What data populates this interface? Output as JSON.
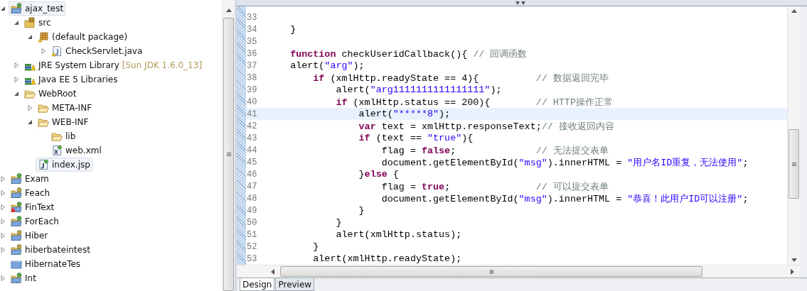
{
  "tree": [
    {
      "label": "ajax_test",
      "kind": "project",
      "expanded": true,
      "selected": true,
      "children": [
        {
          "label": "src",
          "kind": "source-folder",
          "expanded": true,
          "selected": false,
          "children": [
            {
              "label": "(default package)",
              "kind": "package",
              "expanded": true,
              "selected": false,
              "children": [
                {
                  "label": "CheckServlet.java",
                  "kind": "java-file",
                  "expanded": false,
                  "selected": false
                }
              ]
            }
          ]
        },
        {
          "label": "JRE System Library",
          "decoration": "[Sun JDK 1.6.0_13]",
          "kind": "library",
          "expanded": false,
          "selected": false
        },
        {
          "label": "Java EE 5 Libraries",
          "kind": "library",
          "expanded": false,
          "selected": false
        },
        {
          "label": "WebRoot",
          "kind": "folder",
          "expanded": true,
          "selected": false,
          "children": [
            {
              "label": "META-INF",
              "kind": "folder",
              "expanded": false,
              "selected": false
            },
            {
              "label": "WEB-INF",
              "kind": "folder",
              "expanded": true,
              "selected": false,
              "children": [
                {
                  "label": "lib",
                  "kind": "folder",
                  "selected": false
                },
                {
                  "label": "web.xml",
                  "kind": "xml-file",
                  "selected": false
                }
              ]
            },
            {
              "label": "index.jsp",
              "kind": "jsp-file",
              "selected": true
            }
          ]
        }
      ]
    },
    {
      "label": "Exam",
      "kind": "project",
      "expanded": false,
      "selected": false
    },
    {
      "label": "Feach",
      "kind": "project-alt",
      "expanded": false,
      "selected": false
    },
    {
      "label": "FinText",
      "kind": "project-error",
      "expanded": false,
      "selected": false
    },
    {
      "label": "ForEach",
      "kind": "project",
      "expanded": false,
      "selected": false
    },
    {
      "label": "Hiber",
      "kind": "project-alt",
      "expanded": false,
      "selected": false
    },
    {
      "label": "hiberbateintest",
      "kind": "project-alt",
      "expanded": false,
      "selected": false
    },
    {
      "label": "HibernateTes",
      "kind": "closed-project",
      "selected": false
    },
    {
      "label": "Int",
      "kind": "project",
      "expanded": false,
      "selected": false
    }
  ],
  "code": [
    {
      "number": "33",
      "current": false
    },
    {
      "number": "34",
      "current": false,
      "segments": [
        {
          "kind": "plain",
          "text": "    }"
        }
      ]
    },
    {
      "number": "35",
      "current": false
    },
    {
      "number": "36",
      "current": false,
      "segments": [
        {
          "kind": "kw",
          "text": "    function"
        },
        {
          "kind": "plain",
          "text": " checkUseridCallback(){ "
        },
        {
          "kind": "cmt",
          "text": "// 回调函数"
        }
      ]
    },
    {
      "number": "37",
      "current": false,
      "segments": [
        {
          "kind": "plain",
          "text": "    alert("
        },
        {
          "kind": "str",
          "text": "\"arg\""
        },
        {
          "kind": "plain",
          "text": ");"
        }
      ]
    },
    {
      "number": "38",
      "current": false,
      "segments": [
        {
          "kind": "kw",
          "text": "        if"
        },
        {
          "kind": "plain",
          "text": " (xmlHttp.readyState == 4){          "
        },
        {
          "kind": "cmt",
          "text": "// 数据返回完毕"
        }
      ]
    },
    {
      "number": "39",
      "current": false,
      "segments": [
        {
          "kind": "plain",
          "text": "            alert("
        },
        {
          "kind": "str",
          "text": "\"arg1111111111111111\""
        },
        {
          "kind": "plain",
          "text": ");"
        }
      ]
    },
    {
      "number": "40",
      "current": false,
      "segments": [
        {
          "kind": "kw",
          "text": "            if"
        },
        {
          "kind": "plain",
          "text": " (xmlHttp.status == 200){        "
        },
        {
          "kind": "cmt",
          "text": "// HTTP操作正常"
        }
      ]
    },
    {
      "number": "41",
      "current": true,
      "segments": [
        {
          "kind": "plain",
          "text": "                alert("
        },
        {
          "kind": "str",
          "text": "\"*****8\""
        },
        {
          "kind": "plain",
          "text": ");"
        }
      ]
    },
    {
      "number": "42",
      "current": false,
      "segments": [
        {
          "kind": "kw",
          "text": "                var"
        },
        {
          "kind": "plain",
          "text": " text = xmlHttp.responseText;"
        },
        {
          "kind": "cmt",
          "text": "// 接收返回内容"
        }
      ]
    },
    {
      "number": "43",
      "current": false,
      "segments": [
        {
          "kind": "kw",
          "text": "                if"
        },
        {
          "kind": "plain",
          "text": " (text == "
        },
        {
          "kind": "str",
          "text": "\"true\""
        },
        {
          "kind": "plain",
          "text": "){"
        }
      ]
    },
    {
      "number": "44",
      "current": false,
      "segments": [
        {
          "kind": "plain",
          "text": "                    flag = "
        },
        {
          "kind": "kw",
          "text": "false"
        },
        {
          "kind": "plain",
          "text": ";              "
        },
        {
          "kind": "cmt",
          "text": "// 无法提交表单"
        }
      ]
    },
    {
      "number": "45",
      "current": false,
      "segments": [
        {
          "kind": "plain",
          "text": "                    document.getElementById("
        },
        {
          "kind": "str",
          "text": "\"msg\""
        },
        {
          "kind": "plain",
          "text": ").innerHTML = "
        },
        {
          "kind": "str",
          "text": "\"用户名ID重复，无法使用\""
        },
        {
          "kind": "plain",
          "text": ";"
        }
      ]
    },
    {
      "number": "46",
      "current": false,
      "segments": [
        {
          "kind": "plain",
          "text": "                }"
        },
        {
          "kind": "kw",
          "text": "else"
        },
        {
          "kind": "plain",
          "text": " {"
        }
      ]
    },
    {
      "number": "47",
      "current": false,
      "segments": [
        {
          "kind": "plain",
          "text": "                    flag = "
        },
        {
          "kind": "kw",
          "text": "true"
        },
        {
          "kind": "plain",
          "text": ";               "
        },
        {
          "kind": "cmt",
          "text": "// 可以提交表单"
        }
      ]
    },
    {
      "number": "48",
      "current": false,
      "segments": [
        {
          "kind": "plain",
          "text": "                    document.getElementById("
        },
        {
          "kind": "str",
          "text": "\"msg\""
        },
        {
          "kind": "plain",
          "text": ").innerHTML = "
        },
        {
          "kind": "str",
          "text": "\"恭喜！此用户ID可以注册\""
        },
        {
          "kind": "plain",
          "text": ";"
        }
      ]
    },
    {
      "number": "49",
      "current": false,
      "segments": [
        {
          "kind": "plain",
          "text": "                }"
        }
      ]
    },
    {
      "number": "50",
      "current": false,
      "segments": [
        {
          "kind": "plain",
          "text": "            }"
        }
      ]
    },
    {
      "number": "51",
      "current": false,
      "segments": [
        {
          "kind": "plain",
          "text": "            alert(xmlHttp.status);"
        }
      ]
    },
    {
      "number": "52",
      "current": false,
      "segments": [
        {
          "kind": "plain",
          "text": "        }"
        }
      ]
    },
    {
      "number": "53",
      "current": false,
      "segments": [
        {
          "kind": "plain",
          "text": "        alert(xmlHttp.readyState);"
        }
      ]
    }
  ],
  "editor_tabs": [
    {
      "label": "Design",
      "selected": true
    },
    {
      "label": "Preview",
      "selected": false
    }
  ]
}
